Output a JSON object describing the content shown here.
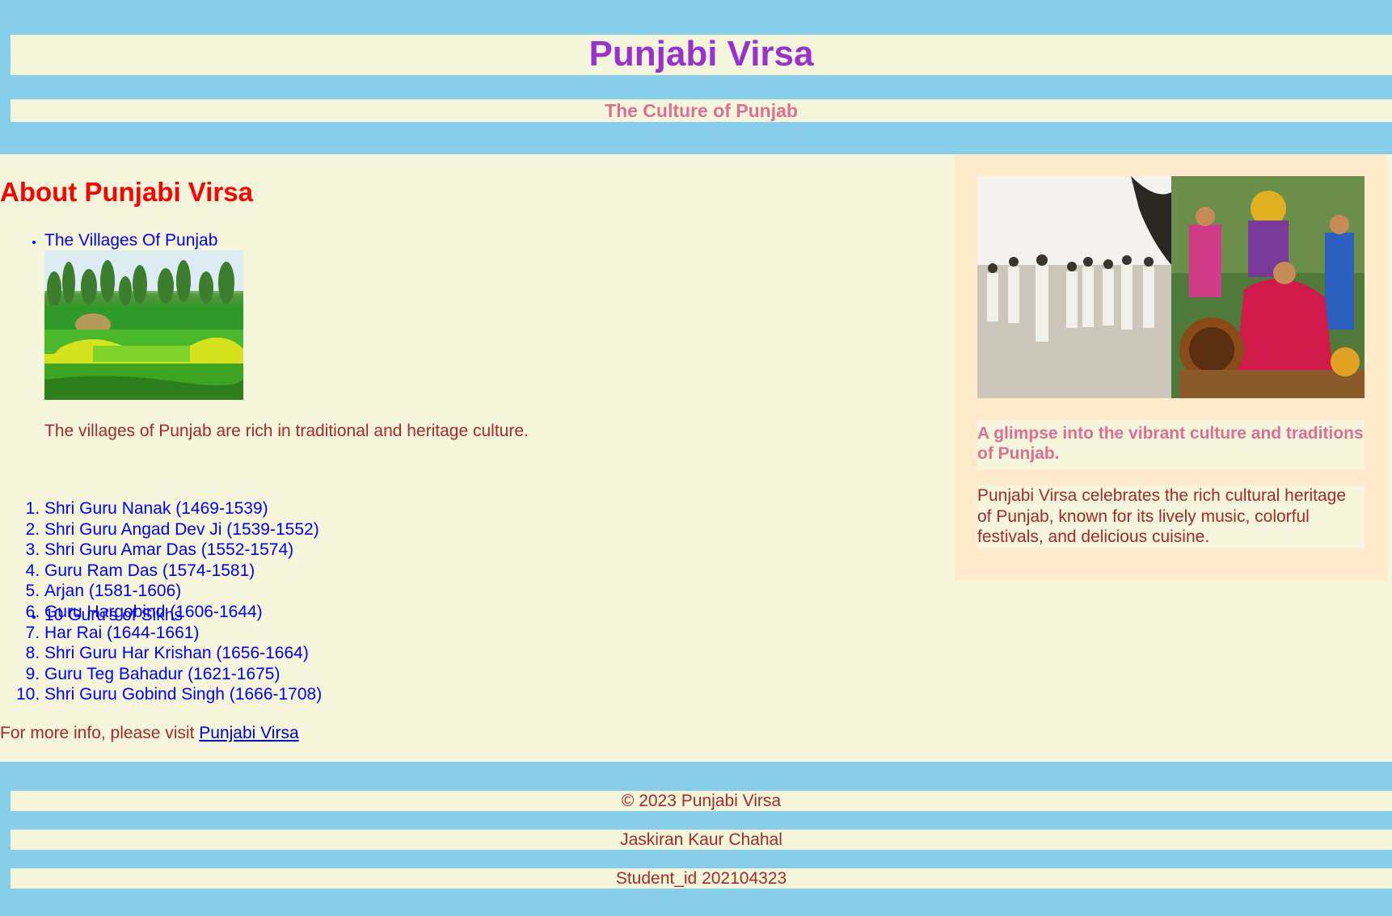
{
  "header": {
    "title": "Punjabi Virsa",
    "subtitle": "The Culture of Punjab"
  },
  "main": {
    "heading": "About Punjabi Virsa",
    "villages": {
      "label": "The Villages Of Punjab",
      "caption": "The villages of Punjab are rich in traditional and heritage culture."
    },
    "gurus": {
      "label": "10 Guru's of Sikhs",
      "items": [
        "Shri Guru Nanak (1469-1539)",
        "Shri Guru Angad Dev Ji (1539-1552)",
        "Shri Guru Amar Das (1552-1574)",
        "Guru Ram Das (1574-1581)",
        "Arjan (1581-1606)",
        "Guru Hargobind (1606-1644)",
        "Har Rai (1644-1661)",
        "Shri Guru Har Krishan (1656-1664)",
        "Guru Teg Bahadur (1621-1675)",
        "Shri Guru Gobind Singh (1666-1708)"
      ]
    },
    "more_info": {
      "text": "For more info, please visit ",
      "link_label": "Punjabi Virsa"
    }
  },
  "sidebar": {
    "glimpse": "A glimpse into the vibrant culture and traditions of Punjab.",
    "description": "Punjabi Virsa celebrates the rich cultural heritage of Punjab, known for its lively music, colorful festivals, and delicious cuisine."
  },
  "footer": {
    "copyright": "© 2023 Punjabi Virsa",
    "author": "Jaskiran Kaur Chahal",
    "student_id": "Student_id 202104323"
  },
  "colors": {
    "header_bg": "#87ceeb",
    "page_bg": "#f5f5dc",
    "title": "#9932cc",
    "subtitle": "#db7093",
    "heading": "#ff0000",
    "list": "#0000ff",
    "body_text": "#a52a2a",
    "sidebar_bg": "#ffeacb"
  }
}
